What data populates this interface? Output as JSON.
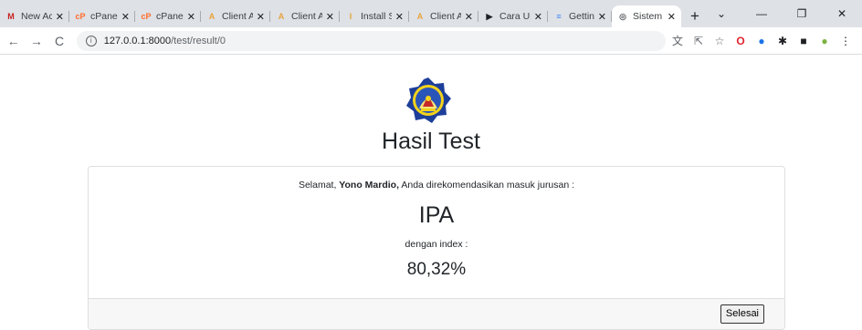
{
  "browser": {
    "tabs": [
      {
        "label": "New Acc",
        "icon": "gmail-icon",
        "color": "#c5221f",
        "glyph": "M"
      },
      {
        "label": "cPanel -",
        "icon": "cpanel-icon",
        "color": "#ff6c2c",
        "glyph": "cP"
      },
      {
        "label": "cPanel -",
        "icon": "cpanel-icon",
        "color": "#ff6c2c",
        "glyph": "cP"
      },
      {
        "label": "Client A",
        "icon": "client-app-icon",
        "color": "#e8a33d",
        "glyph": "A"
      },
      {
        "label": "Client A",
        "icon": "client-app-icon",
        "color": "#e8a33d",
        "glyph": "A"
      },
      {
        "label": "Install S",
        "icon": "install-icon",
        "color": "#e8a33d",
        "glyph": "I"
      },
      {
        "label": "Client A",
        "icon": "client-app-icon",
        "color": "#e8a33d",
        "glyph": "A"
      },
      {
        "label": "Cara Up",
        "icon": "youtube-icon",
        "color": "#202124",
        "glyph": "▶"
      },
      {
        "label": "Getting",
        "icon": "docs-icon",
        "color": "#4285f4",
        "glyph": "≡"
      },
      {
        "label": "Sistem",
        "icon": "globe-icon",
        "color": "#5f6368",
        "glyph": "◎"
      }
    ],
    "active_tab": 9,
    "new_tab": "+",
    "url_host": "127.0.0.1:8000",
    "url_path": "/test/result/0"
  },
  "page": {
    "title": "Hasil Test",
    "message_prefix": "Selamat, ",
    "student_name": "Yono Mardio,",
    "message_suffix": " Anda direkomendasikan masuk jurusan :",
    "major": "IPA",
    "index_label": "dengan index :",
    "index_value": "80,32%",
    "finish_button": "Selesai"
  }
}
